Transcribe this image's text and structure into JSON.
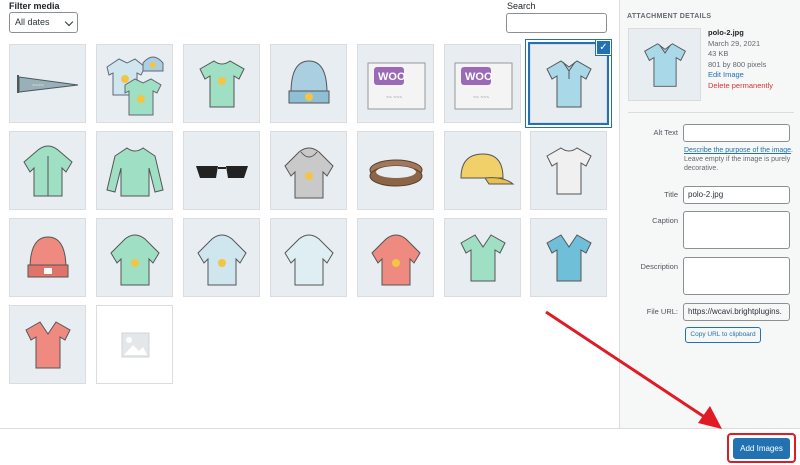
{
  "filter": {
    "label": "Filter media",
    "date_value": "All dates"
  },
  "search": {
    "label": "Search",
    "value": ""
  },
  "grid": {
    "items": [
      {
        "icon": "pennant-icon"
      },
      {
        "icon": "hoodie-bundle-icon"
      },
      {
        "icon": "tshirt-icon"
      },
      {
        "icon": "beanie-icon"
      },
      {
        "icon": "woo-poster-icon"
      },
      {
        "icon": "woo-poster-icon"
      },
      {
        "icon": "polo-icon",
        "selected": true
      },
      {
        "icon": "hoodie-zip-icon"
      },
      {
        "icon": "longsleeve-icon"
      },
      {
        "icon": "sunglasses-icon"
      },
      {
        "icon": "hoodie-gray-icon"
      },
      {
        "icon": "belt-icon"
      },
      {
        "icon": "cap-icon"
      },
      {
        "icon": "tshirt-white-icon"
      },
      {
        "icon": "beanie-red-icon"
      },
      {
        "icon": "hoodie-green-icon"
      },
      {
        "icon": "hoodie-blue-icon"
      },
      {
        "icon": "hoodie-light-icon"
      },
      {
        "icon": "hoodie-red-icon"
      },
      {
        "icon": "vneck-green-icon"
      },
      {
        "icon": "vneck-blue-icon"
      },
      {
        "icon": "vneck-red-icon"
      },
      {
        "icon": "image-placeholder-icon"
      }
    ]
  },
  "attachment": {
    "heading": "ATTACHMENT DETAILS",
    "filename": "polo-2.jpg",
    "date": "March 29, 2021",
    "size": "43 KB",
    "dimensions": "801 by 800 pixels",
    "edit_label": "Edit Image",
    "delete_label": "Delete permanently",
    "alt_label": "Alt Text",
    "alt_value": "",
    "alt_desc_link": "Describe the purpose of the image",
    "alt_desc_rest": ". Leave empty if the image is purely decorative.",
    "title_label": "Title",
    "title_value": "polo-2.jpg",
    "caption_label": "Caption",
    "description_label": "Description",
    "url_label": "File URL:",
    "url_value": "https://wcavi.brightplugins.",
    "copy_label": "Copy URL to clipboard"
  },
  "footer": {
    "add_label": "Add Images"
  },
  "colors": {
    "accent": "#2271b1",
    "annotation": "#e01b24"
  }
}
